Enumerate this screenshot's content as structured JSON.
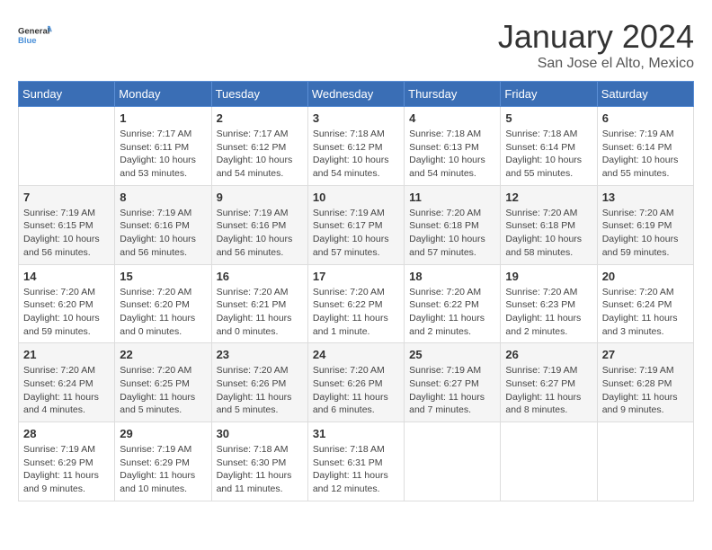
{
  "logo": {
    "line1": "General",
    "line2": "Blue"
  },
  "title": "January 2024",
  "location": "San Jose el Alto, Mexico",
  "days_header": [
    "Sunday",
    "Monday",
    "Tuesday",
    "Wednesday",
    "Thursday",
    "Friday",
    "Saturday"
  ],
  "weeks": [
    [
      {
        "day": "",
        "info": ""
      },
      {
        "day": "1",
        "info": "Sunrise: 7:17 AM\nSunset: 6:11 PM\nDaylight: 10 hours\nand 53 minutes."
      },
      {
        "day": "2",
        "info": "Sunrise: 7:17 AM\nSunset: 6:12 PM\nDaylight: 10 hours\nand 54 minutes."
      },
      {
        "day": "3",
        "info": "Sunrise: 7:18 AM\nSunset: 6:12 PM\nDaylight: 10 hours\nand 54 minutes."
      },
      {
        "day": "4",
        "info": "Sunrise: 7:18 AM\nSunset: 6:13 PM\nDaylight: 10 hours\nand 54 minutes."
      },
      {
        "day": "5",
        "info": "Sunrise: 7:18 AM\nSunset: 6:14 PM\nDaylight: 10 hours\nand 55 minutes."
      },
      {
        "day": "6",
        "info": "Sunrise: 7:19 AM\nSunset: 6:14 PM\nDaylight: 10 hours\nand 55 minutes."
      }
    ],
    [
      {
        "day": "7",
        "info": "Sunrise: 7:19 AM\nSunset: 6:15 PM\nDaylight: 10 hours\nand 56 minutes."
      },
      {
        "day": "8",
        "info": "Sunrise: 7:19 AM\nSunset: 6:16 PM\nDaylight: 10 hours\nand 56 minutes."
      },
      {
        "day": "9",
        "info": "Sunrise: 7:19 AM\nSunset: 6:16 PM\nDaylight: 10 hours\nand 56 minutes."
      },
      {
        "day": "10",
        "info": "Sunrise: 7:19 AM\nSunset: 6:17 PM\nDaylight: 10 hours\nand 57 minutes."
      },
      {
        "day": "11",
        "info": "Sunrise: 7:20 AM\nSunset: 6:18 PM\nDaylight: 10 hours\nand 57 minutes."
      },
      {
        "day": "12",
        "info": "Sunrise: 7:20 AM\nSunset: 6:18 PM\nDaylight: 10 hours\nand 58 minutes."
      },
      {
        "day": "13",
        "info": "Sunrise: 7:20 AM\nSunset: 6:19 PM\nDaylight: 10 hours\nand 59 minutes."
      }
    ],
    [
      {
        "day": "14",
        "info": "Sunrise: 7:20 AM\nSunset: 6:20 PM\nDaylight: 10 hours\nand 59 minutes."
      },
      {
        "day": "15",
        "info": "Sunrise: 7:20 AM\nSunset: 6:20 PM\nDaylight: 11 hours\nand 0 minutes."
      },
      {
        "day": "16",
        "info": "Sunrise: 7:20 AM\nSunset: 6:21 PM\nDaylight: 11 hours\nand 0 minutes."
      },
      {
        "day": "17",
        "info": "Sunrise: 7:20 AM\nSunset: 6:22 PM\nDaylight: 11 hours\nand 1 minute."
      },
      {
        "day": "18",
        "info": "Sunrise: 7:20 AM\nSunset: 6:22 PM\nDaylight: 11 hours\nand 2 minutes."
      },
      {
        "day": "19",
        "info": "Sunrise: 7:20 AM\nSunset: 6:23 PM\nDaylight: 11 hours\nand 2 minutes."
      },
      {
        "day": "20",
        "info": "Sunrise: 7:20 AM\nSunset: 6:24 PM\nDaylight: 11 hours\nand 3 minutes."
      }
    ],
    [
      {
        "day": "21",
        "info": "Sunrise: 7:20 AM\nSunset: 6:24 PM\nDaylight: 11 hours\nand 4 minutes."
      },
      {
        "day": "22",
        "info": "Sunrise: 7:20 AM\nSunset: 6:25 PM\nDaylight: 11 hours\nand 5 minutes."
      },
      {
        "day": "23",
        "info": "Sunrise: 7:20 AM\nSunset: 6:26 PM\nDaylight: 11 hours\nand 5 minutes."
      },
      {
        "day": "24",
        "info": "Sunrise: 7:20 AM\nSunset: 6:26 PM\nDaylight: 11 hours\nand 6 minutes."
      },
      {
        "day": "25",
        "info": "Sunrise: 7:19 AM\nSunset: 6:27 PM\nDaylight: 11 hours\nand 7 minutes."
      },
      {
        "day": "26",
        "info": "Sunrise: 7:19 AM\nSunset: 6:27 PM\nDaylight: 11 hours\nand 8 minutes."
      },
      {
        "day": "27",
        "info": "Sunrise: 7:19 AM\nSunset: 6:28 PM\nDaylight: 11 hours\nand 9 minutes."
      }
    ],
    [
      {
        "day": "28",
        "info": "Sunrise: 7:19 AM\nSunset: 6:29 PM\nDaylight: 11 hours\nand 9 minutes."
      },
      {
        "day": "29",
        "info": "Sunrise: 7:19 AM\nSunset: 6:29 PM\nDaylight: 11 hours\nand 10 minutes."
      },
      {
        "day": "30",
        "info": "Sunrise: 7:18 AM\nSunset: 6:30 PM\nDaylight: 11 hours\nand 11 minutes."
      },
      {
        "day": "31",
        "info": "Sunrise: 7:18 AM\nSunset: 6:31 PM\nDaylight: 11 hours\nand 12 minutes."
      },
      {
        "day": "",
        "info": ""
      },
      {
        "day": "",
        "info": ""
      },
      {
        "day": "",
        "info": ""
      }
    ]
  ]
}
